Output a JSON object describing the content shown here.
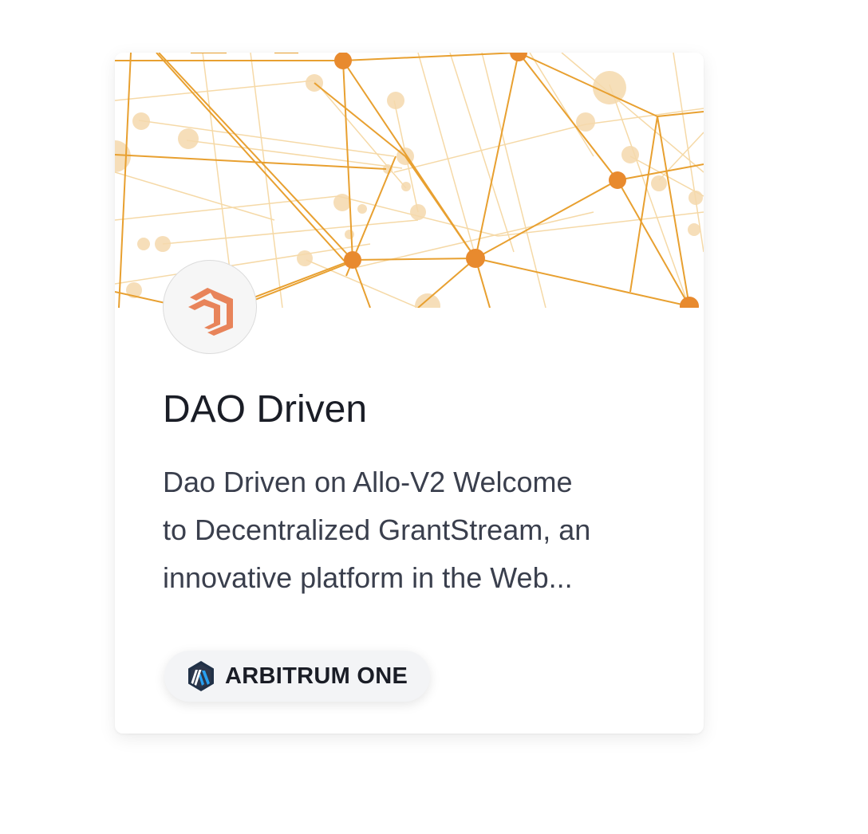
{
  "card": {
    "title": "DAO Driven",
    "description_lines": [
      "Dao Driven on Allo-V2 Welcome",
      "to Decentralized GrantStream, an",
      "innovative platform in the Web..."
    ],
    "banner_image": "network-graph-banner",
    "logo_icon": "dao-driven-logo-icon",
    "chain": {
      "label": "ARBITRUM ONE",
      "icon": "arbitrum-icon"
    }
  },
  "colors": {
    "accent_orange": "#e88a2e",
    "line_orange": "#e8a030",
    "logo_orange": "#e8845a",
    "title_text": "#1a1d26",
    "body_text": "#3a3f4d",
    "badge_bg": "#f3f4f6",
    "arbitrum_blue": "#28a0f0",
    "arbitrum_navy": "#213147"
  }
}
